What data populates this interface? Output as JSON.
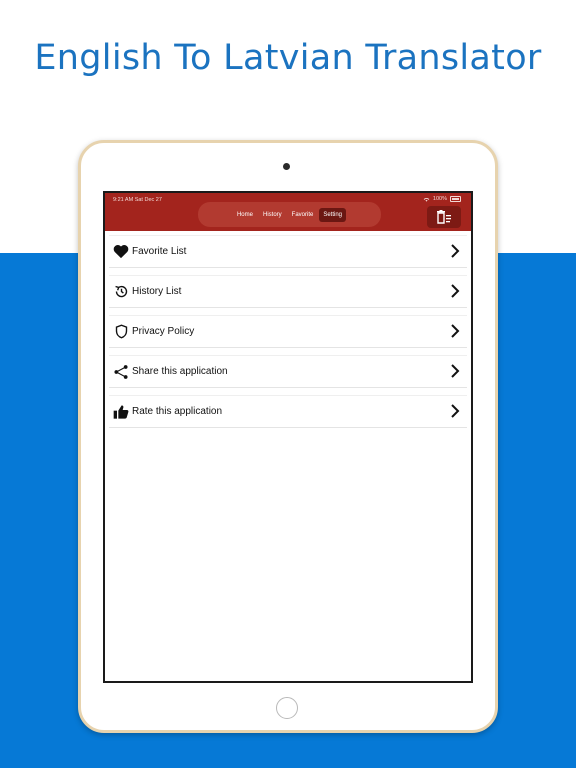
{
  "headline": "English To Latvian Translator",
  "status_bar": {
    "time_date": "9:21 AM   Sat Dec 27",
    "battery": "100%"
  },
  "tabs": [
    {
      "label": "Home",
      "active": false
    },
    {
      "label": "History",
      "active": false
    },
    {
      "label": "Favorite",
      "active": false
    },
    {
      "label": "Setting",
      "active": true
    }
  ],
  "settings_items": [
    {
      "label": "Favorite List",
      "icon": "heart-icon"
    },
    {
      "label": "History List",
      "icon": "history-icon"
    },
    {
      "label": "Privacy Policy",
      "icon": "shield-icon"
    },
    {
      "label": "Share this application",
      "icon": "share-icon"
    },
    {
      "label": "Rate this application",
      "icon": "thumbs-up-icon"
    }
  ],
  "colors": {
    "navbar": "#a3241d",
    "background_blue": "#0679d6",
    "headline": "#1b73c0"
  }
}
